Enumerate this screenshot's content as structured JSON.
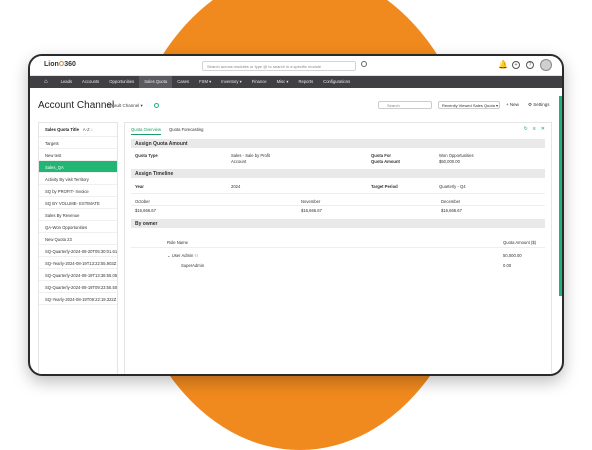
{
  "app": {
    "logo_prefix": "Lion",
    "logo_o": "O",
    "logo_suffix": "360"
  },
  "search": {
    "placeholder": "Search across modules or type @ to search in a specific module"
  },
  "header_icons": [
    "bell-icon",
    "plus-icon",
    "help-icon",
    "avatar"
  ],
  "nav": {
    "items": [
      {
        "label": "Leads"
      },
      {
        "label": "Accounts"
      },
      {
        "label": "Opportunities"
      },
      {
        "label": "Sales Quota",
        "active": true
      },
      {
        "label": "Cases"
      },
      {
        "label": "FSM ▾"
      },
      {
        "label": "Inventory ▾"
      },
      {
        "label": "Finance"
      },
      {
        "label": "Misc ▾"
      },
      {
        "label": "Reports"
      },
      {
        "label": "Configurations"
      }
    ]
  },
  "page": {
    "title": "Account Channel",
    "view": "Default Channel ▾",
    "search_placeholder": "Search",
    "recent": "Recently Viewed Sales Quota ▾",
    "new_label": "+ New",
    "settings_label": "Settings"
  },
  "left": {
    "header": "Sales Quota Title",
    "sort": "A-Z ↓",
    "items": [
      {
        "label": "Targets"
      },
      {
        "label": "New test"
      },
      {
        "label": "Sales_QA",
        "active": true
      },
      {
        "label": "Activity By visit Territory"
      },
      {
        "label": "SQ by PROFIT- Invoice"
      },
      {
        "label": "SQ BY VOLUME- ESTIMATE"
      },
      {
        "label": "Sales By Revenue"
      },
      {
        "label": "QA-Won Opportunities"
      },
      {
        "label": "New Quota 23"
      },
      {
        "label": "SQ-Quarterly-2024-08-20T05:30:01.617Z"
      },
      {
        "label": "SQ-Yearly-2024-08-19T13:22:55.903Z"
      },
      {
        "label": "SQ-Quarterly-2024-08-19T13:36:55.056Z"
      },
      {
        "label": "SQ-Quarterly-2024-08-19T09:23:55.505Z"
      },
      {
        "label": "SQ-Yearly-2024-08-19T09:22:19.322Z"
      }
    ]
  },
  "main": {
    "tabs": [
      {
        "label": "Quota Overview",
        "active": true
      },
      {
        "label": "Quota Forecasting"
      }
    ],
    "assign_quota": {
      "title": "Assign Quota Amount",
      "quota_type_label": "Quota Type",
      "quota_type_value": "Sales - Sale by Profit",
      "quota_type_value2": "Account",
      "quota_for_label": "Quota For",
      "quota_for_value": "Won Opportunities",
      "quota_amount_label": "Quota Amount",
      "quota_amount_value": "$50,000.00"
    },
    "assign_timeline": {
      "title": "Assign Timeline",
      "year_label": "Year",
      "year_value": "2024",
      "target_label": "Target Period",
      "target_value": "Quarterly - Q4",
      "months": [
        {
          "name": "October",
          "amount": "$16,666.67"
        },
        {
          "name": "November",
          "amount": "$16,666.67"
        },
        {
          "name": "December",
          "amount": "$16,666.67"
        }
      ]
    },
    "by_owner": {
      "title": "By owner",
      "col_role": "Role Name",
      "col_amount": "Quota Amount ($)",
      "rows": [
        {
          "name": "User Admin",
          "amount": "50,000.00"
        },
        {
          "name": "SuperAdmin",
          "amount": "0.00"
        }
      ]
    }
  },
  "colors": {
    "accent": "#23b574",
    "orange": "#f18a1e",
    "nav_bg": "#3f3f44"
  }
}
